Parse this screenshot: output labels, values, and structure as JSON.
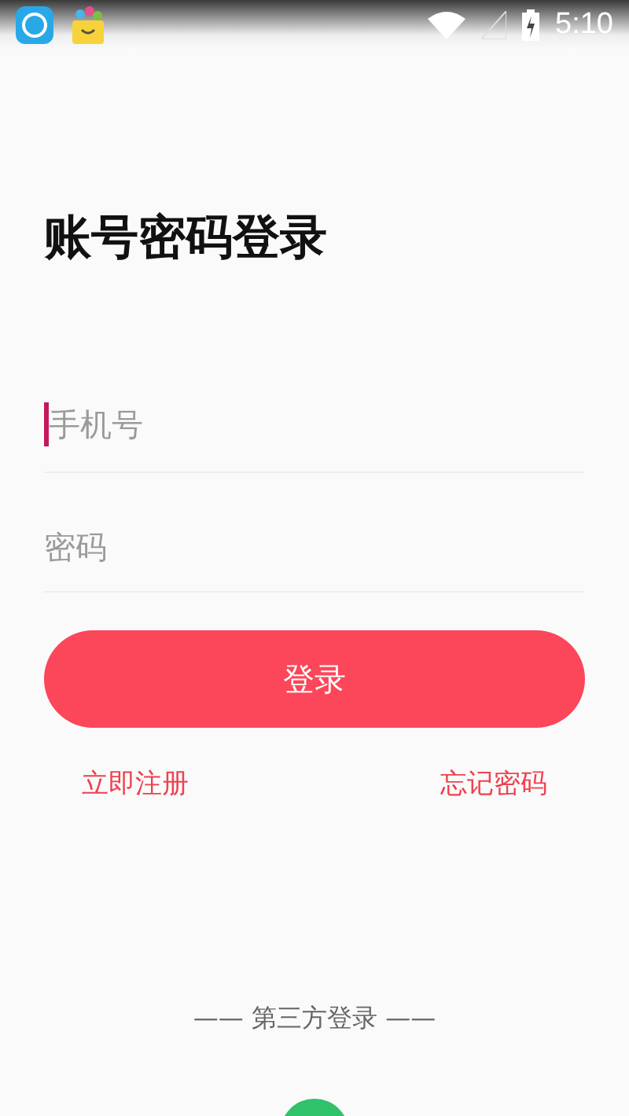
{
  "status_bar": {
    "time": "5:10"
  },
  "title": "账号密码登录",
  "fields": [
    {
      "placeholder": "手机号",
      "focused": true
    },
    {
      "placeholder": "密码",
      "focused": false
    }
  ],
  "login_button": "登录",
  "links": [
    "立即注册",
    "忘记密码"
  ],
  "third_party": {
    "label": "—— 第三方登录 ——"
  }
}
